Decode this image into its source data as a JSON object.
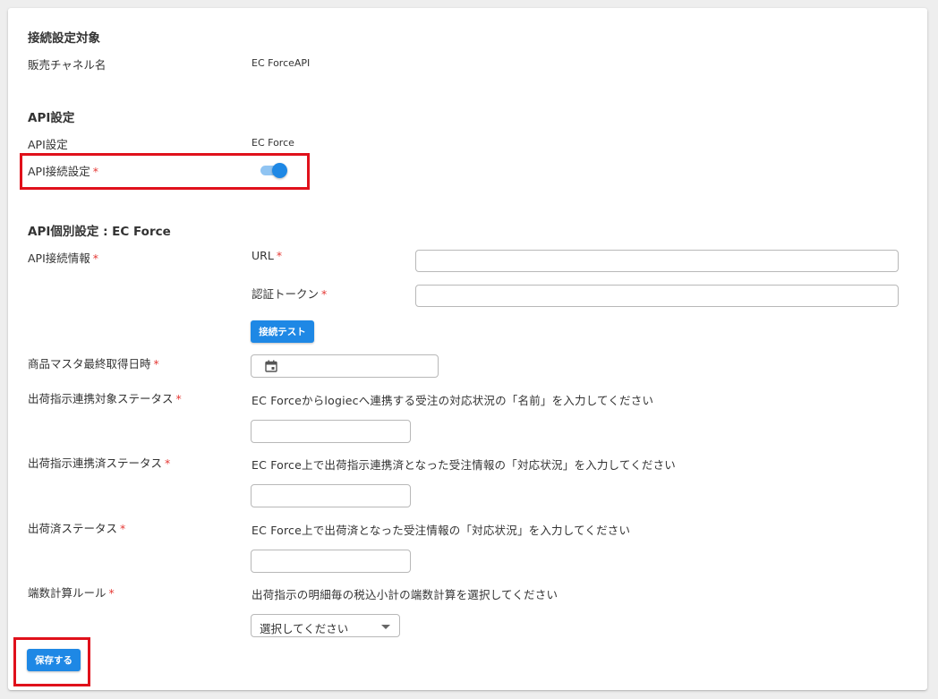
{
  "sections": {
    "connection_target": {
      "title": "接続設定対象",
      "sales_channel_label": "販売チャネル名",
      "sales_channel_value": "EC ForceAPI"
    },
    "api_settings": {
      "title": "API設定",
      "api_setting_label": "API設定",
      "api_setting_value": "EC Force",
      "api_connection_label": "API接続設定",
      "api_connection_enabled": true
    },
    "api_individual": {
      "title": "API個別設定 : EC Force",
      "connection_info_label": "API接続情報",
      "url_label": "URL",
      "url_value": "",
      "token_label": "認証トークン",
      "token_value": "",
      "test_button": "接続テスト",
      "product_master_label": "商品マスタ最終取得日時",
      "product_master_value": "",
      "shipping_target_status_label": "出荷指示連携対象ステータス",
      "shipping_target_status_hint": "EC Forceからlogiecへ連携する受注の対応状況の「名前」を入力してください",
      "shipping_target_status_value": "",
      "shipping_linked_status_label": "出荷指示連携済ステータス",
      "shipping_linked_status_hint": "EC Force上で出荷指示連携済となった受注情報の「対応状況」を入力してください",
      "shipping_linked_status_value": "",
      "shipped_status_label": "出荷済ステータス",
      "shipped_status_hint": "EC Force上で出荷済となった受注情報の「対応状況」を入力してください",
      "shipped_status_value": "",
      "rounding_rule_label": "端数計算ルール",
      "rounding_rule_hint": "出荷指示の明細毎の税込小計の端数計算を選択してください",
      "rounding_rule_selected": "選択してください"
    }
  },
  "required_mark": "*",
  "save_button": "保存する",
  "colors": {
    "accent": "#1e88e5",
    "toggle_track": "#90c4f2",
    "required": "#e53935",
    "highlight": "#e0111b",
    "background": "#eeeeee"
  },
  "icons": {
    "date_picker": "calendar-icon",
    "select_arrow": "chevron-down-icon"
  }
}
